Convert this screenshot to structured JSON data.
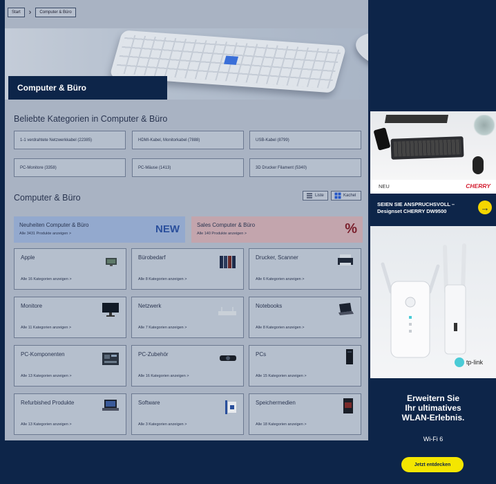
{
  "breadcrumb": {
    "start": "Start",
    "current": "Computer & Büro"
  },
  "hero": {
    "title": "Computer & Büro"
  },
  "popular": {
    "title": "Beliebte Kategorien in Computer & Büro",
    "items": [
      "1-1 verdrahtete Netzwerkkabel (22385)",
      "HDMI-Kabel, Monitorkabel (7888)",
      "USB-Kabel (8799)",
      "PC-Monitore (3358)",
      "PC-Mäuse (1413)",
      "3D Drucker Filament (5340)"
    ]
  },
  "categories": {
    "title": "Computer & Büro",
    "view_list": "Liste",
    "view_tiles": "Kachel",
    "promo_new": {
      "title": "Neuheiten Computer & Büro",
      "link": "Alle 3431 Produkte anzeigen >",
      "badge": "NEW"
    },
    "promo_sales": {
      "title": "Sales Computer & Büro",
      "link": "Alle 140 Produkte anzeigen >",
      "badge": "%"
    },
    "tiles": [
      {
        "label": "Apple",
        "link": "Alle 16 Kategorien anzeigen >"
      },
      {
        "label": "Bürobedarf",
        "link": "Alle 8 Kategorien anzeigen >"
      },
      {
        "label": "Drucker, Scanner",
        "link": "Alle 6 Kategorien anzeigen >"
      },
      {
        "label": "Monitore",
        "link": "Alle 11 Kategorien anzeigen >"
      },
      {
        "label": "Netzwerk",
        "link": "Alle 7 Kategorien anzeigen >"
      },
      {
        "label": "Notebooks",
        "link": "Alle 8 Kategorien anzeigen >"
      },
      {
        "label": "PC-Komponenten",
        "link": "Alle 13 Kategorien anzeigen >"
      },
      {
        "label": "PC-Zubehör",
        "link": "Alle 16 Kategorien anzeigen >"
      },
      {
        "label": "PCs",
        "link": "Alle 15 Kategorien anzeigen >"
      },
      {
        "label": "Refurbished Produkte",
        "link": "Alle 13 Kategorien anzeigen >"
      },
      {
        "label": "Software",
        "link": "Alle 3 Kategorien anzeigen >"
      },
      {
        "label": "Speichermedien",
        "link": "Alle 18 Kategorien anzeigen >"
      }
    ]
  },
  "ad_cherry": {
    "new": "NEU",
    "brand": "CHERRY",
    "line1": "SEIEN SIE ANSPRUCHSVOLL –",
    "line2": "Designset CHERRY DW9500",
    "arrow": "→"
  },
  "ad_tplink": {
    "logo": "tp-link",
    "line1": "Erweitern Sie",
    "line2": "Ihr ultimatives",
    "line3": "WLAN-Erlebnis.",
    "sub": "Wi-Fi 6",
    "cta": "Jetzt entdecken"
  },
  "colors": {
    "navy": "#0d2549",
    "page_dim": "#a9b3c3",
    "cta_yellow": "#f4e600",
    "cherry_red": "#d31c2f"
  }
}
